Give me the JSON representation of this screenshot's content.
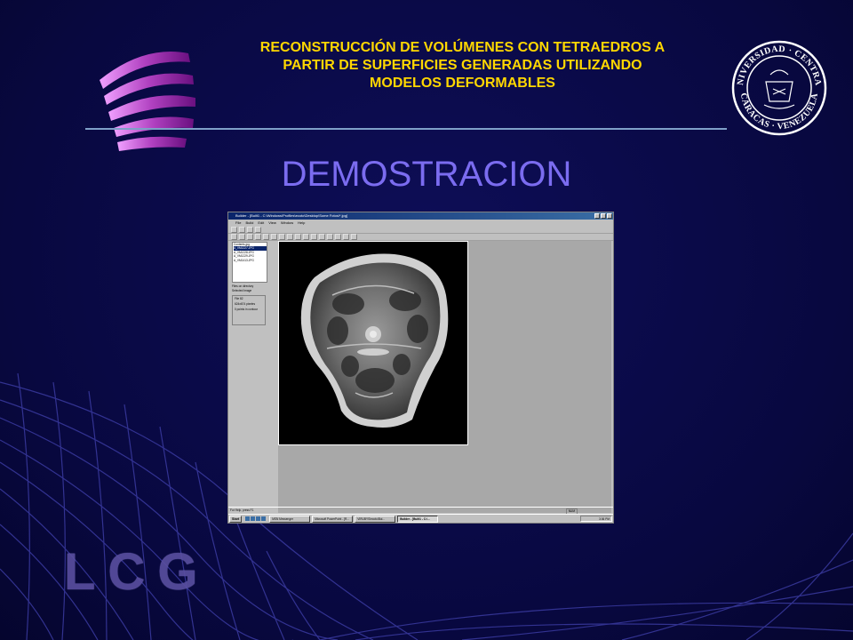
{
  "slide": {
    "title_lines": [
      "RECONSTRUCCIÓN DE VOLÚMENES CON TETRAEDROS A",
      "PARTIR DE SUPERFICIES GENERADAS UTILIZANDO",
      "MODELOS DEFORMABLES"
    ],
    "subtitle": "DEMOSTRACION",
    "footer_logo": "LCG",
    "colors": {
      "background": "#0a0a4a",
      "title": "#ffd700",
      "subtitle": "#7b6cf0",
      "rule": "#7fa0c8"
    }
  },
  "seal": {
    "top_text": "UNIVERSIDAD · CENTRAL",
    "bottom_text": "CARACAS · VENEZUELA"
  },
  "app": {
    "window_title": "Builder - [Built1 - C:\\Windows\\Profiles\\ecoto\\Desktop\\Some Fotos\\*.jpg]",
    "menu": [
      "File",
      "Build",
      "Edit",
      "View",
      "Window",
      "Help"
    ],
    "file_list": [
      "Contents.jpg",
      "A_VM1227.JPG",
      "A_VM1228.JPG",
      "A_VM1229.JPG",
      "A_VM1413.JPG"
    ],
    "selected_file_index": 1,
    "files_label": "Files on directory",
    "selected_image_label": "Selected Image",
    "info": [
      "File 82",
      "624x674 pixeles",
      "0 points in contour"
    ],
    "status_left": "For Help, press F1",
    "status_right": "NUM",
    "taskbar": {
      "start": "Start",
      "tasks": [
        "MSN Messenger",
        "Microsoft PowerPoint - [R...",
        "VIRUBYS\\ecoto\\Bui...",
        "Builder - [Built1 - C:\\..."
      ],
      "active_task_index": 3,
      "clock": "3:36 PM"
    }
  }
}
